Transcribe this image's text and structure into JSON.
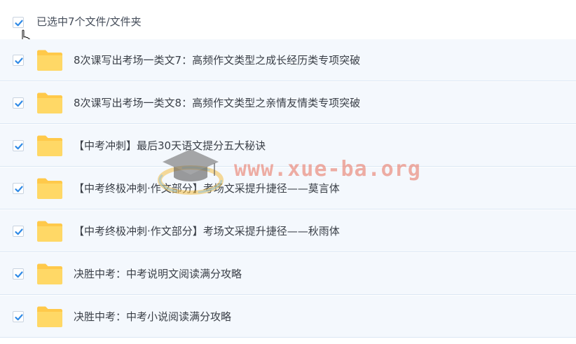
{
  "header": {
    "selected_text": "已选中7个文件/文件夹"
  },
  "rows": [
    {
      "label": "8次课写出考场一类文7：高频作文类型之成长经历类专项突破"
    },
    {
      "label": "8次课写出考场一类文8：高频作文类型之亲情友情类专项突破"
    },
    {
      "label": "【中考冲刺】最后30天语文提分五大秘诀"
    },
    {
      "label": "【中考终极冲刺·作文部分】考场文采提升捷径——莫言体"
    },
    {
      "label": "【中考终极冲刺·作文部分】考场文采提升捷径——秋雨体"
    },
    {
      "label": "决胜中考：中考说明文阅读满分攻略"
    },
    {
      "label": "决胜中考：中考小说阅读满分攻略"
    }
  ],
  "watermark": {
    "text": "www.xue-ba.org"
  },
  "colors": {
    "check": "#2f8ae6",
    "folder": "#ffd35c",
    "row_bg": "#f4f8fd"
  }
}
